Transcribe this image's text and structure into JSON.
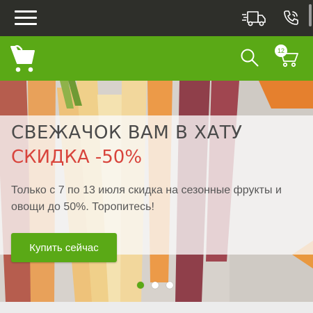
{
  "header": {
    "menu_icon": "hamburger-menu-icon",
    "delivery_icon": "delivery-truck-icon",
    "phone_icon": "phone-call-icon"
  },
  "nav": {
    "logo_icon": "shopping-cart-logo-icon",
    "search_icon": "search-icon",
    "cart_icon": "cart-icon",
    "cart_count": "12"
  },
  "hero": {
    "title": "СВЕЖАЧОК ВАМ В ХАТУ",
    "subtitle": "СКИДКА -50%",
    "description": "Только с 7 по 13 июля скидка на сезонные фрукты и овощи до 50%. Торопитесь!",
    "cta_label": "Купить сейчас",
    "slides_total": 3,
    "active_slide": 1
  },
  "colors": {
    "topbar": "#2e2f2a",
    "accent": "#5aa916",
    "title_text": "#4a4a4a",
    "discount_text": "#d8443c"
  }
}
